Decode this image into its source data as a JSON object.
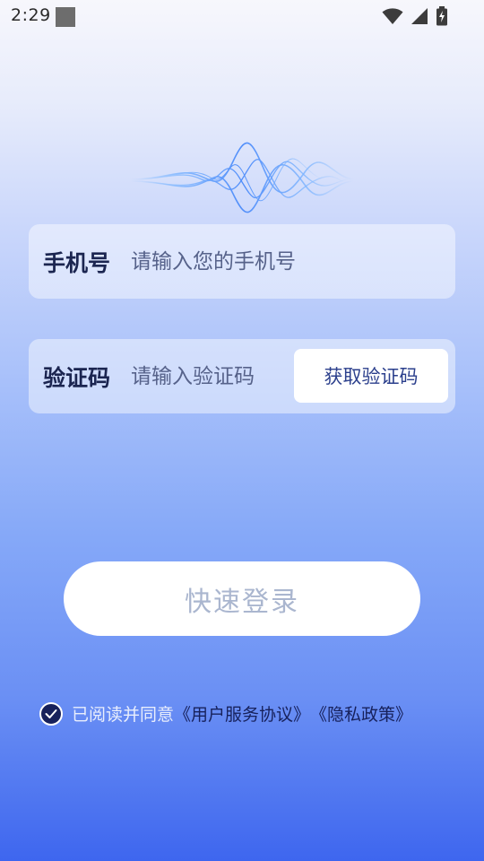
{
  "status_bar": {
    "time": "2:29",
    "icons": [
      "wifi-icon",
      "cellular-signal-icon",
      "battery-charging-icon"
    ]
  },
  "header": {
    "icon": "sound-wave-icon",
    "wave_colors": [
      "#7fb6ff",
      "#4f8dfa",
      "#9ec9ff"
    ]
  },
  "phone_field": {
    "label": "手机号",
    "placeholder": "请输入您的手机号",
    "value": ""
  },
  "code_field": {
    "label": "验证码",
    "placeholder": "请输入验证码",
    "value": "",
    "get_code_label": "获取验证码"
  },
  "login": {
    "label": "快速登录"
  },
  "agreement": {
    "checked": true,
    "prefix": "已阅读并同意",
    "user_agreement": "《用户服务协议》",
    "privacy_policy": "《隐私政策》"
  },
  "colors": {
    "label_text": "#1b2550",
    "link_text": "#17215b",
    "button_text": "#2b3f8c",
    "login_disabled_text": "#aab6cf"
  }
}
